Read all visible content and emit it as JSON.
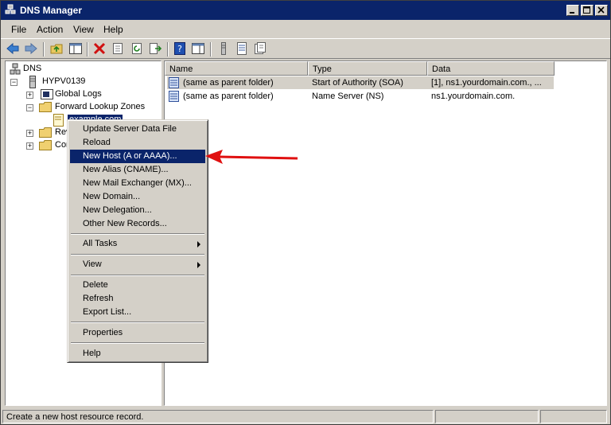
{
  "window": {
    "title": "DNS Manager"
  },
  "menubar": {
    "items": [
      {
        "label": "File"
      },
      {
        "label": "Action"
      },
      {
        "label": "View"
      },
      {
        "label": "Help"
      }
    ]
  },
  "toolbar": {
    "buttons": [
      "back-icon",
      "forward-icon",
      "up-folder-icon",
      "show-hide-tree-icon",
      "delete-icon",
      "properties-icon",
      "refresh-icon",
      "export-list-icon",
      "help-icon",
      "show-hide-action-pane-icon",
      "server-icon",
      "zone-icon",
      "records-icon"
    ]
  },
  "tree": {
    "root": "DNS",
    "server": "HYPV0139",
    "global_logs": "Global Logs",
    "forward_zones": "Forward Lookup Zones",
    "zone": "example.com",
    "reverse_zones": "Rev",
    "conditional": "Con"
  },
  "list": {
    "columns": [
      {
        "label": "Name"
      },
      {
        "label": "Type"
      },
      {
        "label": "Data"
      }
    ],
    "rows": [
      {
        "name": "(same as parent folder)",
        "type": "Start of Authority (SOA)",
        "data": "[1], ns1.yourdomain.com., ..."
      },
      {
        "name": "(same as parent folder)",
        "type": "Name Server (NS)",
        "data": "ns1.yourdomain.com."
      }
    ]
  },
  "context_menu": {
    "update": "Update Server Data File",
    "reload": "Reload",
    "new_host": "New Host (A or AAAA)...",
    "new_alias": "New Alias (CNAME)...",
    "new_mx": "New Mail Exchanger (MX)...",
    "new_domain": "New Domain...",
    "new_delegation": "New Delegation...",
    "other_records": "Other New Records...",
    "all_tasks": "All Tasks",
    "view": "View",
    "delete": "Delete",
    "refresh": "Refresh",
    "export": "Export List...",
    "properties": "Properties",
    "help": "Help"
  },
  "statusbar": {
    "text": "Create a new host resource record."
  },
  "colors": {
    "title_bar": "#0a246a",
    "highlight": "#0a246a",
    "annotation_arrow": "#e01010",
    "chrome": "#d4d0c8"
  }
}
